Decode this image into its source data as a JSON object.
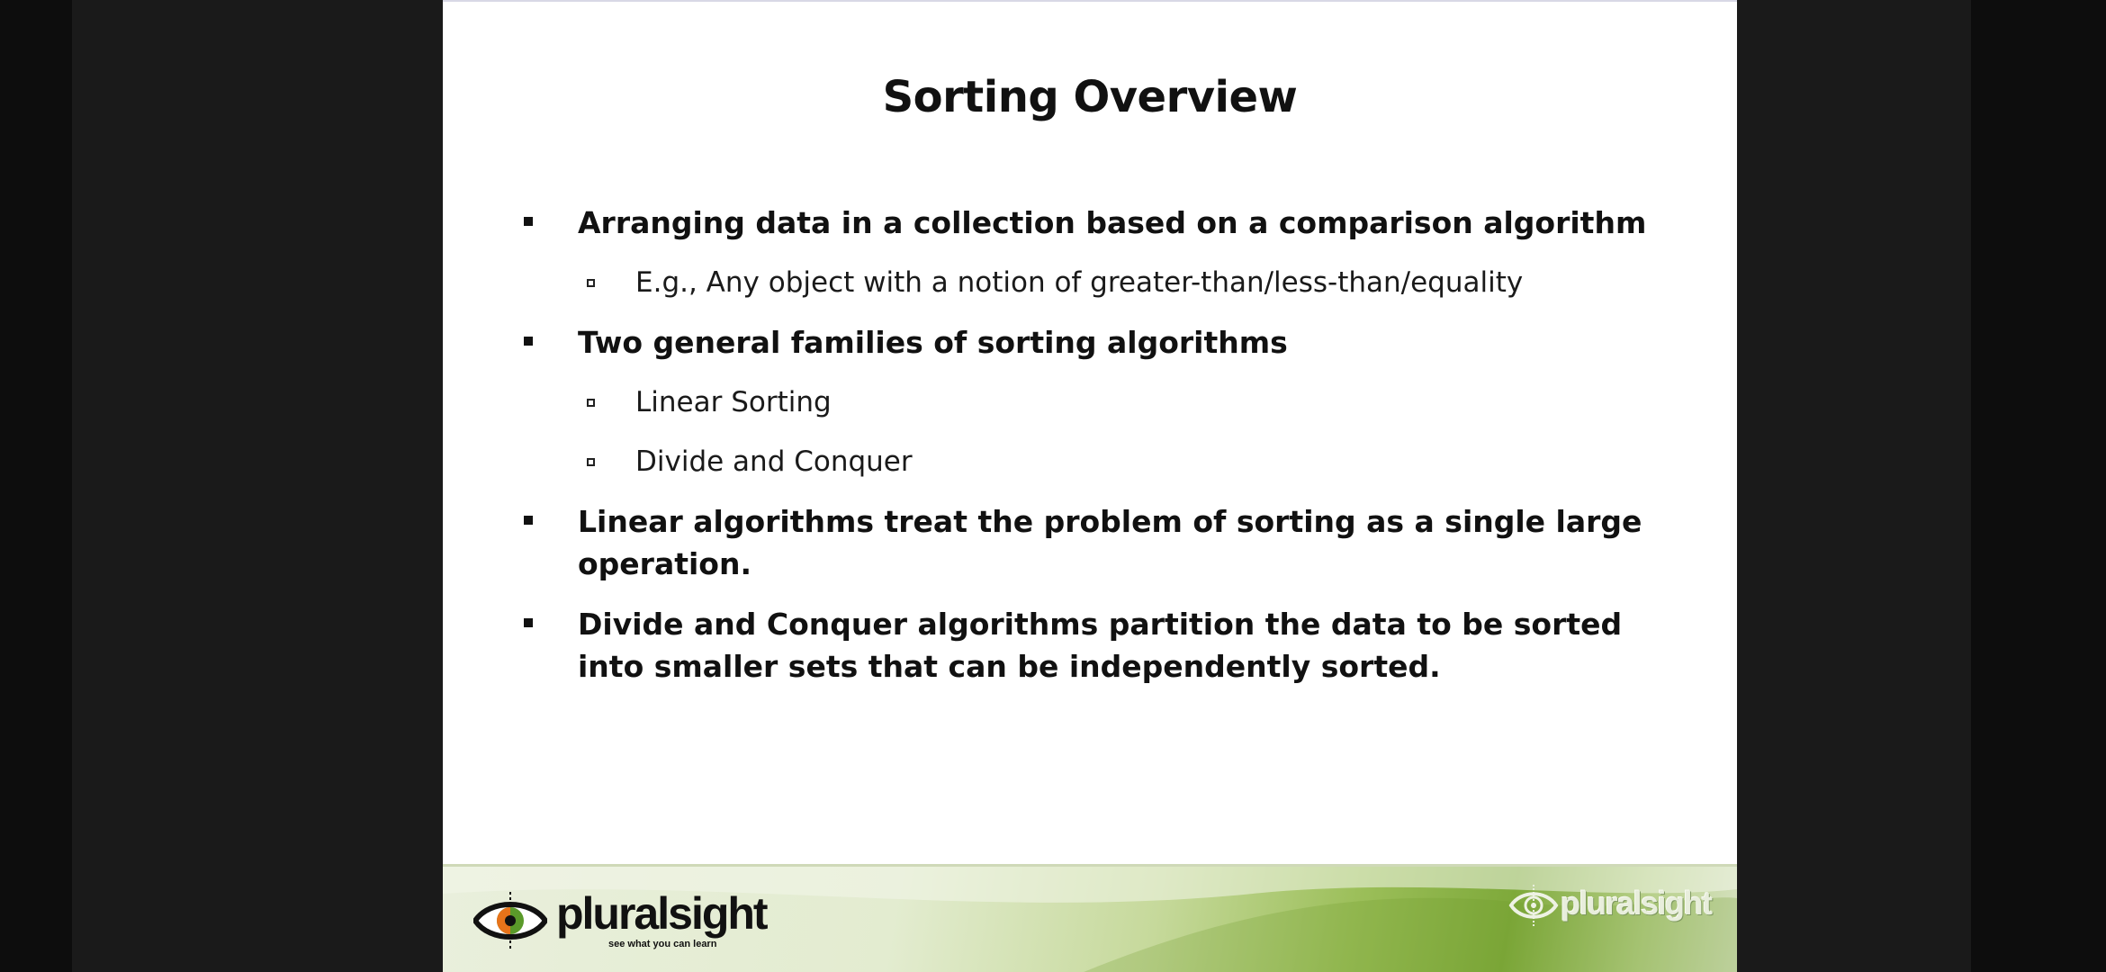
{
  "slide": {
    "title": "Sorting Overview",
    "bullets": [
      {
        "level": 1,
        "text": "Arranging data in a collection based on a comparison algorithm"
      },
      {
        "level": 2,
        "text": "E.g., Any object with a notion of greater-than/less-than/equality"
      },
      {
        "level": 1,
        "text": "Two general families of sorting algorithms"
      },
      {
        "level": 2,
        "text": "Linear Sorting"
      },
      {
        "level": 2,
        "text": "Divide and Conquer"
      },
      {
        "level": 1,
        "text": "Linear algorithms treat the problem of sorting as a single large operation."
      },
      {
        "level": 1,
        "text": "Divide and Conquer algorithms partition the data to be sorted into smaller sets that can be independently  sorted."
      }
    ]
  },
  "footer": {
    "brand": "pluralsight",
    "tagline": "see what you can learn",
    "watermark_brand": "pluralsight",
    "colors": {
      "footer_green": "#9cbf5a",
      "eye_orange": "#e8731a",
      "eye_green": "#5a9a2a"
    }
  }
}
